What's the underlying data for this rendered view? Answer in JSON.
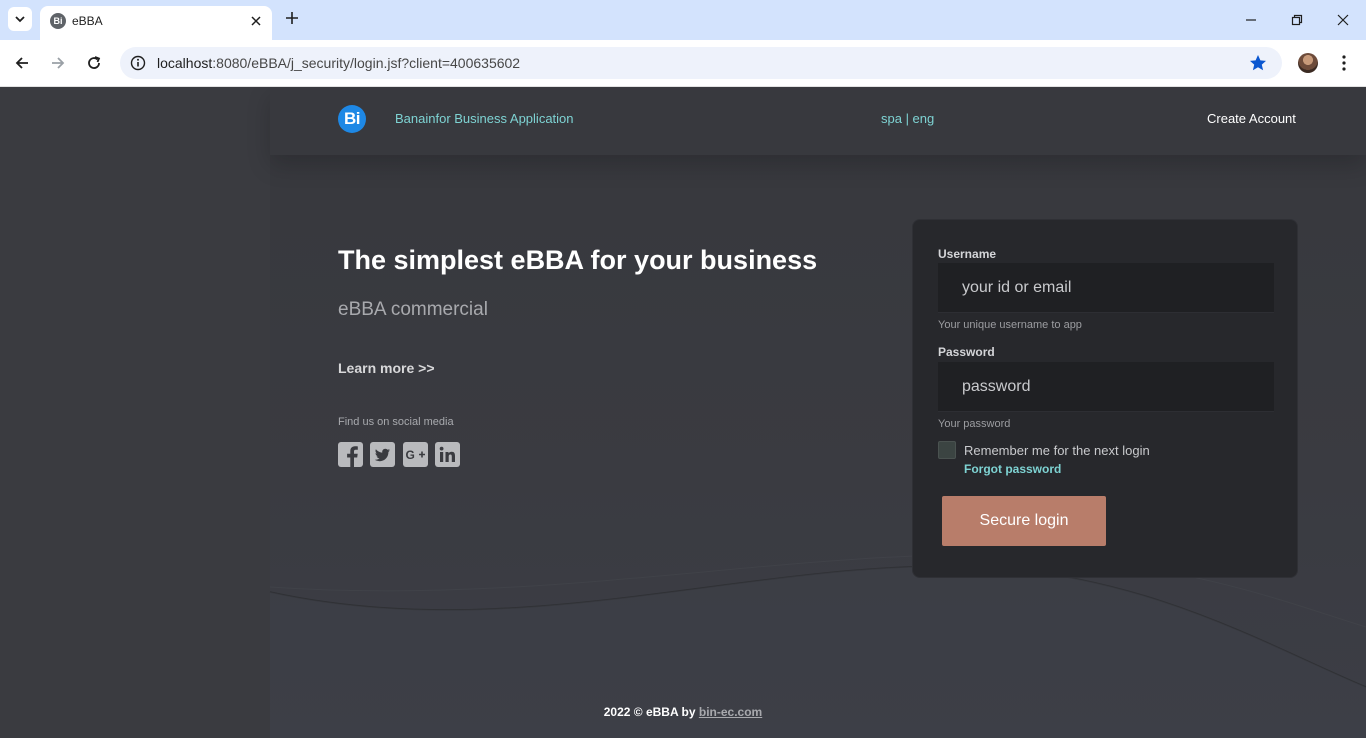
{
  "browser": {
    "tab_title": "eBBA",
    "tab_favicon_text": "Bi",
    "url_host": "localhost",
    "url_path": ":8080/eBBA/j_security/login.jsf?client=400635602"
  },
  "header": {
    "logo_text": "Bi",
    "app_name": "Banainfor Business Application",
    "language_switch": "spa | eng",
    "create_account": "Create Account"
  },
  "hero": {
    "headline": "The simplest eBBA for your business",
    "subheadline": "eBBA commercial",
    "learn_more": "Learn more >>",
    "social_label": "Find us on social media",
    "social_icons": [
      "facebook-icon",
      "twitter-icon",
      "google-plus-icon",
      "linkedin-icon"
    ]
  },
  "login": {
    "username_label": "Username",
    "username_placeholder": "your id or email",
    "username_hint": "Your unique username to app",
    "password_label": "Password",
    "password_placeholder": "password",
    "password_hint": "Your password",
    "remember_label": "Remember me for the next login",
    "forgot_password": "Forgot password",
    "submit_label": "Secure login"
  },
  "footer": {
    "text": "2022 © eBBA by",
    "link": "bin-ec.com"
  },
  "colors": {
    "accent_teal": "#7ed3d3",
    "button": "#b87d6a",
    "logo_blue": "#1e88e5",
    "page_bg": "#3a3b40",
    "card_bg": "#27282c"
  }
}
